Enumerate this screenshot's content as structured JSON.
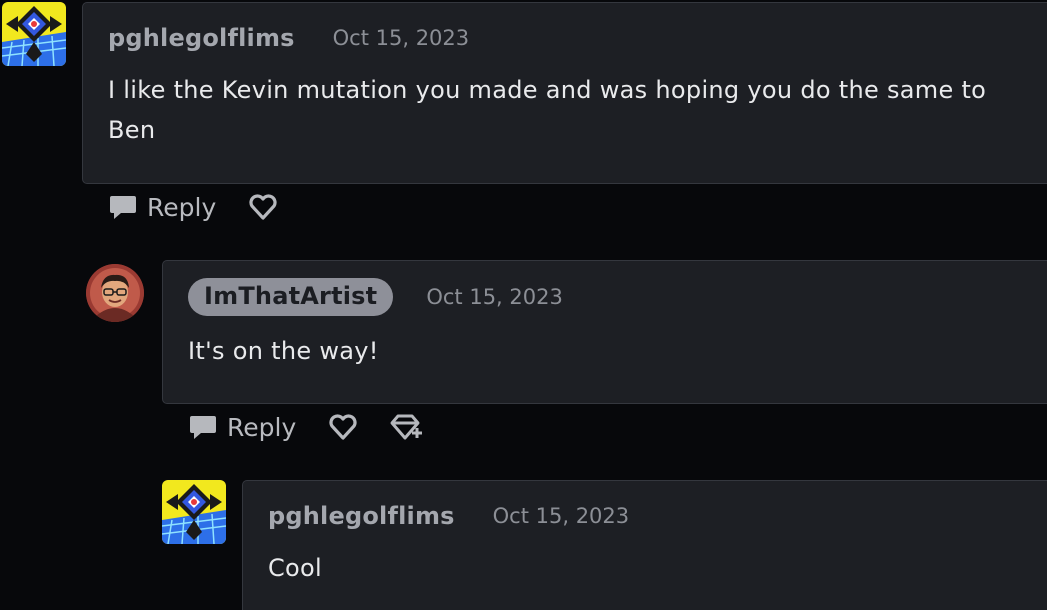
{
  "comments": [
    {
      "author": "pghlegolflims",
      "date": "Oct 15, 2023",
      "body": "I like the Kevin mutation you made and was hoping you do the same to Ben",
      "reply_label": "Reply"
    },
    {
      "author": "ImThatArtist",
      "date": "Oct 15, 2023",
      "body": "It's on the way!",
      "reply_label": "Reply"
    },
    {
      "author": "pghlegolflims",
      "date": "Oct 15, 2023",
      "body": "Cool"
    }
  ],
  "icons": {
    "reply": "speech-bubble-icon",
    "like": "heart-icon",
    "give_award": "award-icon"
  },
  "colors": {
    "background": "#07080b",
    "card": "#1d1f24",
    "op_badge": "#8e9099",
    "text": "#e9eaec",
    "muted": "#8c8f96"
  }
}
